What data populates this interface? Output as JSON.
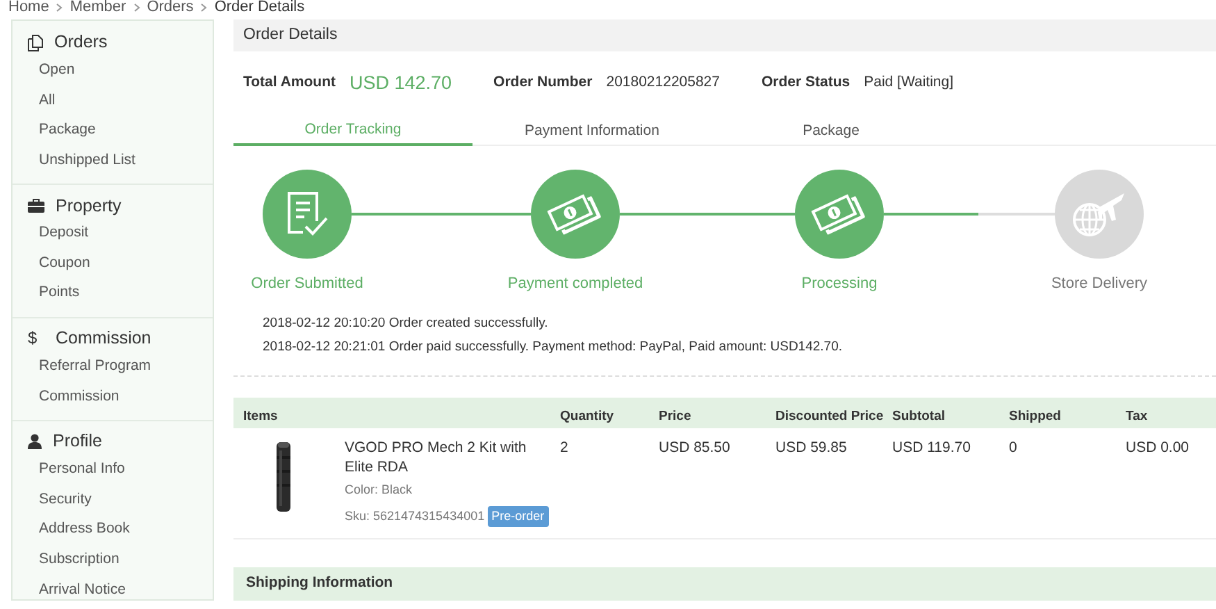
{
  "breadcrumb": [
    "Home",
    "Member",
    "Orders",
    "Order Details"
  ],
  "sidebar": {
    "sections": [
      {
        "title": "Orders",
        "items": [
          "Open",
          "All",
          "Package",
          "Unshipped List"
        ]
      },
      {
        "title": "Property",
        "items": [
          "Deposit",
          "Coupon",
          "Points"
        ]
      },
      {
        "title": "Commission",
        "icon_glyph": "$",
        "items": [
          "Referral Program",
          "Commission"
        ]
      },
      {
        "title": "Profile",
        "items": [
          "Personal Info",
          "Security",
          "Address Book",
          "Subscription",
          "Arrival Notice"
        ]
      }
    ]
  },
  "panel_title": "Order Details",
  "summary": [
    {
      "label": "Total Amount",
      "value": "USD 142.70",
      "highlight": true
    },
    {
      "label": "Order Number",
      "value": "20180212205827",
      "highlight": false
    },
    {
      "label": "Order Status",
      "value": "Paid [Waiting]",
      "highlight": false
    }
  ],
  "tabs": [
    {
      "label": "Order Tracking",
      "selected": true
    },
    {
      "label": "Payment Information",
      "selected": false
    },
    {
      "label": "Package",
      "selected": false
    }
  ],
  "steps": [
    {
      "label": "Order Submitted",
      "kind": "document",
      "done": true
    },
    {
      "label": "Payment completed",
      "kind": "money",
      "done": true
    },
    {
      "label": "Processing",
      "kind": "money",
      "done": true
    },
    {
      "label": "Store Delivery",
      "kind": "delivery",
      "done": false
    }
  ],
  "log": [
    "2018-02-12 20:10:20 Order created successfully.",
    "2018-02-12 20:21:01 Order paid successfully. Payment method: PayPal, Paid amount: USD142.70."
  ],
  "table": {
    "columns": [
      "Items",
      "Quantity",
      "Price",
      "Discounted Price",
      "Subtotal",
      "Shipped",
      "Tax"
    ],
    "rows": [
      {
        "item": {
          "name": "VGOD PRO Mech 2 Kit with Elite RDA",
          "variant": "Color: Black",
          "sku": "Sku: 5621474315434001",
          "badge": "Pre-order"
        },
        "quantity": "2",
        "price": "USD 85.50",
        "discounted_price": "USD 59.85",
        "subtotal": "USD 119.70",
        "shipped": "0",
        "tax": "USD 0.00"
      }
    ]
  },
  "shipping_title": "Shipping Information"
}
